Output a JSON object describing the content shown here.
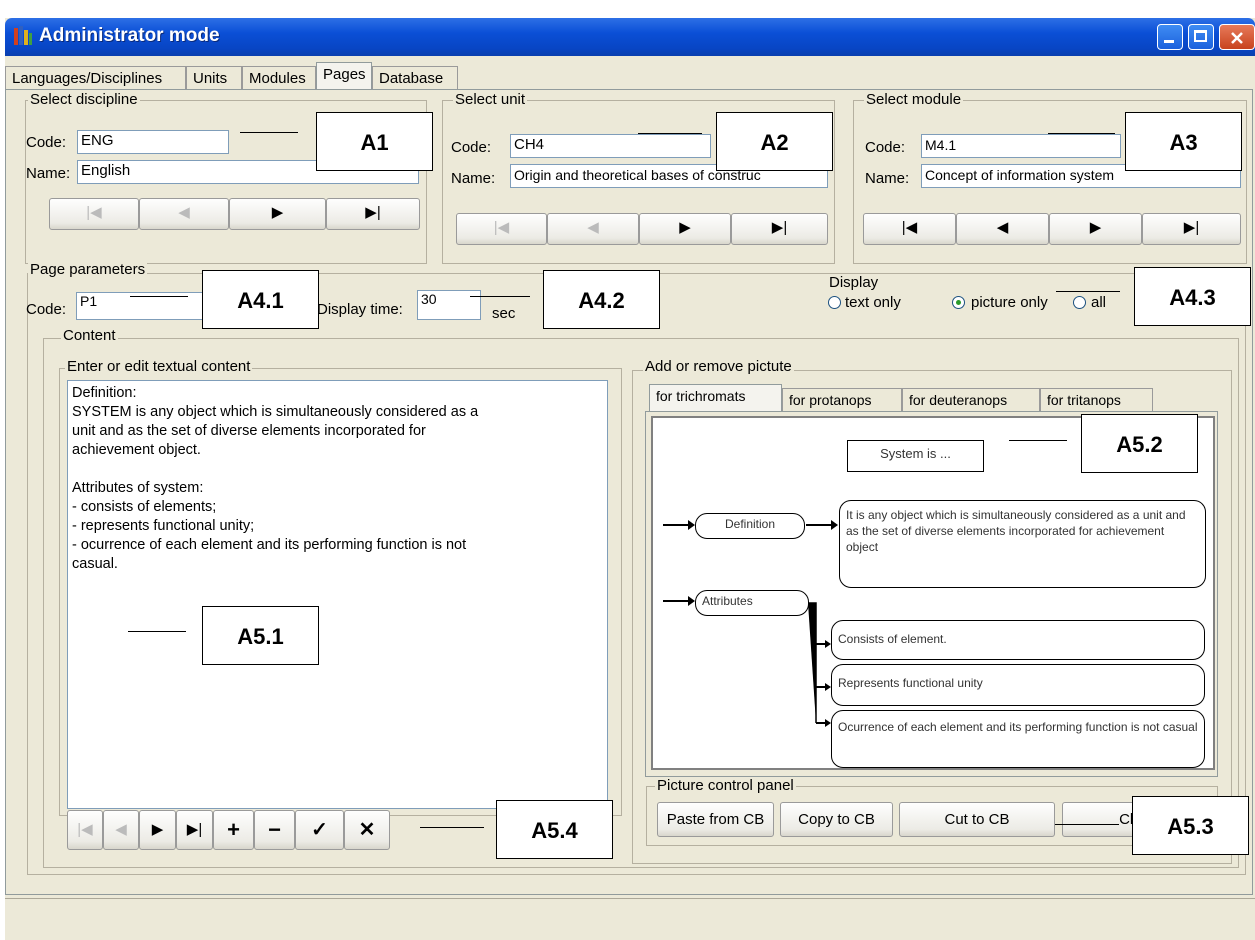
{
  "window": {
    "title": "Administrator mode"
  },
  "tabs": [
    "Languages/Disciplines",
    "Units",
    "Modules",
    "Pages",
    "Database"
  ],
  "active_tab": "Pages",
  "discipline": {
    "legend": "Select discipline",
    "code_label": "Code:",
    "code": "ENG",
    "name_label": "Name:",
    "name": "English"
  },
  "unit": {
    "legend": "Select unit",
    "code_label": "Code:",
    "code": "CH4",
    "name_label": "Name:",
    "name": "Origin and theoretical bases of construc"
  },
  "module": {
    "legend": "Select module",
    "code_label": "Code:",
    "code": "M4.1",
    "name_label": "Name:",
    "name": "Concept of information system"
  },
  "page_params": {
    "legend": "Page parameters",
    "code_label": "Code:",
    "code": "P1",
    "display_time_label": "Display time:",
    "display_time": "30",
    "display_time_unit": "sec"
  },
  "display": {
    "legend": "Display",
    "options": [
      "text only",
      "picture only",
      "all"
    ],
    "selected": "picture only"
  },
  "content": {
    "legend": "Content",
    "text_legend": "Enter or edit textual content",
    "text": "Definition:\nSYSTEM is any object which is simultaneously considered as a\nunit and as the set of diverse elements incorporated for\nachievement object.\n\nAttributes of system:\n- consists of elements;\n- represents functional unity;\n- ocurrence of each element and its performing function is not\ncasual.",
    "picture_legend": "Add or remove pictute",
    "picture_tabs": [
      "for trichromats",
      "for protanops",
      "for deuteranops",
      "for tritanops"
    ],
    "active_picture_tab": "for trichromats"
  },
  "diagram": {
    "title_box": "System is ...",
    "definition_label": "Definition",
    "definition_text": "It is any object which is simultaneously considered as a unit and as the set of diverse elements incorporated for achievement object",
    "attributes_label": "Attributes",
    "attr1": "Consists of element.",
    "attr2": "Represents functional unity",
    "attr3": "Ocurrence of each element and its performing function is not casual"
  },
  "picture_panel": {
    "legend": "Picture control panel",
    "buttons": [
      "Paste from CB",
      "Copy to CB",
      "Cut to CB",
      "Clear"
    ]
  },
  "annotations": {
    "a1": "A1",
    "a2": "A2",
    "a3": "A3",
    "a41": "A4.1",
    "a42": "A4.2",
    "a43": "A4.3",
    "a51": "A5.1",
    "a52": "A5.2",
    "a53": "A5.3",
    "a54": "A5.4"
  },
  "icons": {
    "first": "first-record-icon",
    "prev": "prev-record-icon",
    "next": "next-record-icon",
    "last": "last-record-icon",
    "add": "plus-icon",
    "delete": "minus-icon",
    "post": "check-icon",
    "cancel": "cross-icon"
  }
}
